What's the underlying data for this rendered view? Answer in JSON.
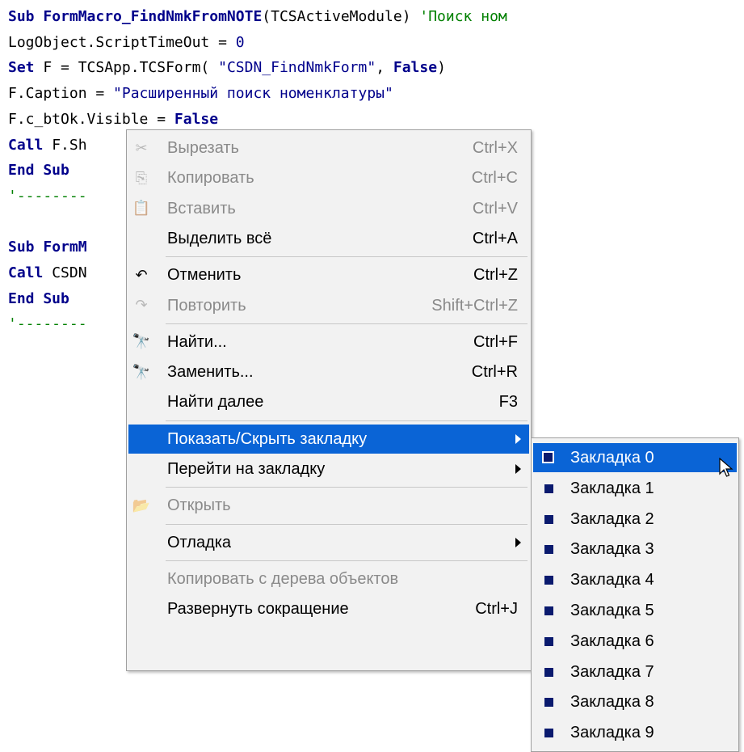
{
  "code_lines": [
    {
      "parts": [
        {
          "t": "Sub ",
          "c": "kw"
        },
        {
          "t": "FormMacro_FindNmkFromNOTE",
          "c": "bold"
        },
        {
          "t": "(TCSActiveModule) ",
          "c": ""
        },
        {
          "t": "'Поиск ном",
          "c": "cm"
        }
      ]
    },
    {
      "parts": [
        {
          "t": "LogObject.ScriptTimeOut = ",
          "c": ""
        },
        {
          "t": "0",
          "c": "num"
        }
      ]
    },
    {
      "parts": [
        {
          "t": "Set ",
          "c": "kw"
        },
        {
          "t": "F = TCSApp.TCSForm( ",
          "c": ""
        },
        {
          "t": "\"CSDN_FindNmkForm\"",
          "c": "str"
        },
        {
          "t": ", ",
          "c": ""
        },
        {
          "t": "False",
          "c": "kw"
        },
        {
          "t": ")",
          "c": ""
        }
      ]
    },
    {
      "parts": [
        {
          "t": "F.Caption = ",
          "c": ""
        },
        {
          "t": "\"Расширенный поиск номенклатуры\"",
          "c": "str"
        }
      ]
    },
    {
      "parts": [
        {
          "t": "F.c_btOk.Visible = ",
          "c": ""
        },
        {
          "t": "False",
          "c": "kw"
        }
      ]
    },
    {
      "parts": [
        {
          "t": "Call ",
          "c": "kw"
        },
        {
          "t": "F.Sh",
          "c": ""
        }
      ]
    },
    {
      "parts": [
        {
          "t": "End Sub",
          "c": "kw"
        }
      ]
    },
    {
      "parts": [
        {
          "t": "'--------",
          "c": "cm"
        }
      ]
    },
    {
      "parts": []
    },
    {
      "parts": [
        {
          "t": "Sub ",
          "c": "kw"
        },
        {
          "t": "FormM",
          "c": "bold"
        }
      ]
    },
    {
      "parts": [
        {
          "t": "Call ",
          "c": "kw"
        },
        {
          "t": "CSDN",
          "c": ""
        }
      ]
    },
    {
      "parts": [
        {
          "t": "End Sub",
          "c": "kw"
        }
      ]
    },
    {
      "parts": [
        {
          "t": "'--------",
          "c": "cm"
        }
      ]
    }
  ],
  "context_menu": {
    "items": [
      {
        "label": "Вырезать",
        "shortcut": "Ctrl+X",
        "icon": "✂",
        "icon_name": "cut-icon",
        "disabled": true,
        "name": "menu-cut"
      },
      {
        "label": "Копировать",
        "shortcut": "Ctrl+C",
        "icon": "⎘",
        "icon_name": "copy-icon",
        "disabled": true,
        "name": "menu-copy"
      },
      {
        "label": "Вставить",
        "shortcut": "Ctrl+V",
        "icon": "📋",
        "icon_name": "paste-icon",
        "disabled": true,
        "name": "menu-paste"
      },
      {
        "label": "Выделить всё",
        "shortcut": "Ctrl+A",
        "icon": "",
        "icon_name": "",
        "disabled": false,
        "name": "menu-select-all"
      },
      {
        "sep": true
      },
      {
        "label": "Отменить",
        "shortcut": "Ctrl+Z",
        "icon": "↶",
        "icon_name": "undo-icon",
        "disabled": false,
        "name": "menu-undo"
      },
      {
        "label": "Повторить",
        "shortcut": "Shift+Ctrl+Z",
        "icon": "↷",
        "icon_name": "redo-icon",
        "disabled": true,
        "name": "menu-redo"
      },
      {
        "sep": true
      },
      {
        "label": "Найти...",
        "shortcut": "Ctrl+F",
        "icon": "🔭",
        "icon_name": "binoculars-icon",
        "disabled": false,
        "name": "menu-find"
      },
      {
        "label": "Заменить...",
        "shortcut": "Ctrl+R",
        "icon": "🔭",
        "icon_name": "replace-binoculars-icon",
        "disabled": false,
        "name": "menu-replace"
      },
      {
        "label": "Найти далее",
        "shortcut": "F3",
        "icon": "",
        "icon_name": "",
        "disabled": false,
        "name": "menu-find-next"
      },
      {
        "sep": true
      },
      {
        "label": "Показать/Скрыть закладку",
        "shortcut": "",
        "submenu": true,
        "highlighted": true,
        "icon": "",
        "icon_name": "",
        "disabled": false,
        "name": "menu-toggle-bookmark"
      },
      {
        "label": "Перейти на закладку",
        "shortcut": "",
        "submenu": true,
        "icon": "",
        "icon_name": "",
        "disabled": false,
        "name": "menu-goto-bookmark"
      },
      {
        "sep": true
      },
      {
        "label": "Открыть",
        "shortcut": "",
        "icon": "📂",
        "icon_name": "open-folder-icon",
        "disabled": true,
        "name": "menu-open"
      },
      {
        "sep": true
      },
      {
        "label": "Отладка",
        "shortcut": "",
        "submenu": true,
        "icon": "",
        "icon_name": "",
        "disabled": false,
        "name": "menu-debug"
      },
      {
        "sep": true
      },
      {
        "label": "Копировать с дерева объектов",
        "shortcut": "",
        "icon": "",
        "icon_name": "",
        "disabled": true,
        "name": "menu-copy-from-tree"
      },
      {
        "label": "Развернуть сокращение",
        "shortcut": "Ctrl+J",
        "icon": "",
        "icon_name": "",
        "disabled": false,
        "name": "menu-expand-abbrev"
      }
    ]
  },
  "submenu": {
    "items": [
      "Закладка 0",
      "Закладка 1",
      "Закладка 2",
      "Закладка 3",
      "Закладка 4",
      "Закладка 5",
      "Закладка 6",
      "Закладка 7",
      "Закладка 8",
      "Закладка 9"
    ],
    "highlighted_index": 0
  },
  "colors": {
    "highlight": "#0a64d6",
    "keyword": "#00008b",
    "comment": "#008000",
    "disabled": "#8a8a8a",
    "bullet": "#0a1a6e"
  }
}
